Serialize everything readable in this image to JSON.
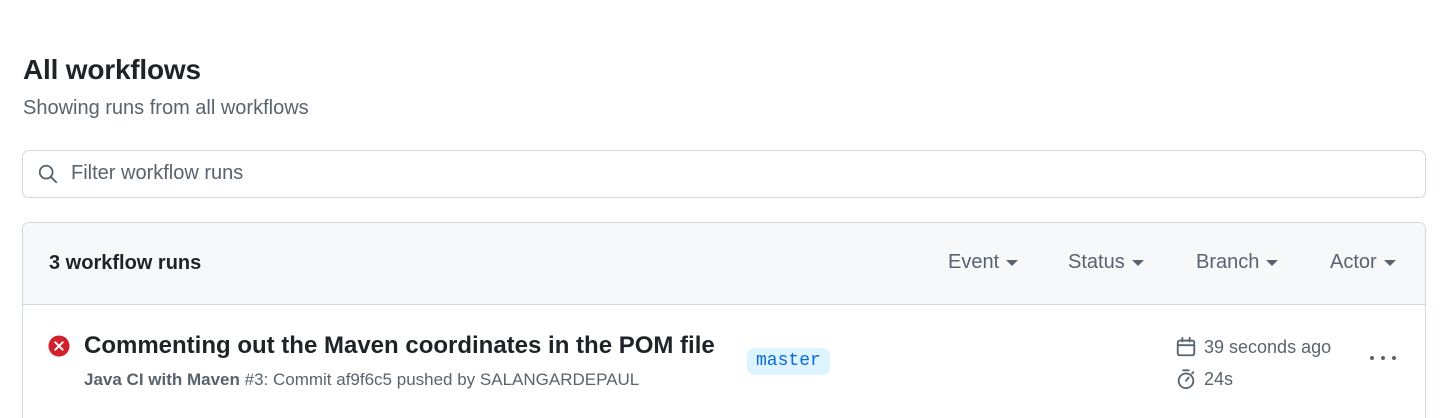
{
  "page": {
    "title": "All workflows",
    "subtitle": "Showing runs from all workflows"
  },
  "search": {
    "placeholder": "Filter workflow runs",
    "value": ""
  },
  "runs_header": {
    "count_label": "3 workflow runs",
    "filters": [
      "Event",
      "Status",
      "Branch",
      "Actor"
    ]
  },
  "runs": [
    {
      "status": "failure",
      "title": "Commenting out the Maven coordinates in the POM file",
      "workflow": "Java CI with Maven",
      "details": " #3: Commit af9f6c5 pushed by SALANGARDEPAUL",
      "branch": "master",
      "time_ago": "39 seconds ago",
      "duration": "24s"
    }
  ],
  "colors": {
    "failure": "#cf222e",
    "branch_bg": "#ddf4ff",
    "branch_fg": "#0969da",
    "muted": "#59636e"
  },
  "icons": {
    "search": "search-icon",
    "status": "x-circle-fill-icon",
    "calendar": "calendar-icon",
    "stopwatch": "stopwatch-icon",
    "more": "kebab-horizontal-icon"
  }
}
